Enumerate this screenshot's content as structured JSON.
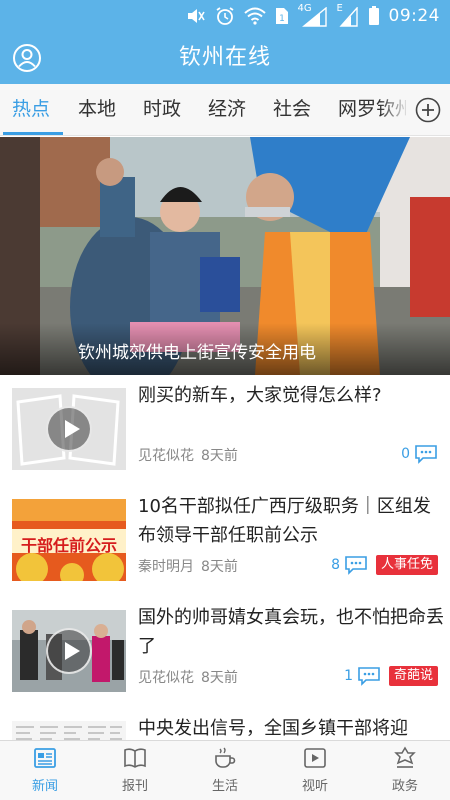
{
  "status_bar": {
    "network": "4G",
    "network2": "E",
    "time": "09:24"
  },
  "header": {
    "title": "钦州在线",
    "profile_icon": "user-circle-icon"
  },
  "tabs": [
    {
      "label": "热点",
      "active": true
    },
    {
      "label": "本地",
      "active": false
    },
    {
      "label": "时政",
      "active": false
    },
    {
      "label": "经济",
      "active": false
    },
    {
      "label": "社会",
      "active": false
    },
    {
      "label": "网罗钦州",
      "active": false
    }
  ],
  "hero": {
    "caption": "钦州城郊供电上街宣传安全用电"
  },
  "news": [
    {
      "title": "刚买的新车，大家觉得怎么样?",
      "source": "见花似花",
      "time": "8天前",
      "comments": "0",
      "tag": "",
      "video": true
    },
    {
      "title": "10名干部拟任广西厅级职务｜区组发布领导干部任职前公示",
      "source": "秦时明月",
      "time": "8天前",
      "comments": "8",
      "tag": "人事任免",
      "thumb_text": "干部任前公示",
      "video": false
    },
    {
      "title": "国外的帅哥婧女真会玩，也不怕把命丢了",
      "source": "见花似花",
      "time": "8天前",
      "comments": "1",
      "tag": "奇葩说",
      "video": true
    },
    {
      "title": "中央发出信号，全国乡镇干部将迎",
      "source": "",
      "time": "",
      "comments": "",
      "tag": "",
      "video": false
    }
  ],
  "bottom_nav": [
    {
      "label": "新闻",
      "icon": "newspaper-icon",
      "active": true
    },
    {
      "label": "报刊",
      "icon": "book-icon",
      "active": false
    },
    {
      "label": "生活",
      "icon": "coffee-cup-icon",
      "active": false
    },
    {
      "label": "视听",
      "icon": "video-play-icon",
      "active": false
    },
    {
      "label": "政务",
      "icon": "government-building-icon",
      "active": false
    }
  ],
  "colors": {
    "primary": "#5cb3e8",
    "accent": "#3a9ee4",
    "tag": "#e8313b"
  }
}
